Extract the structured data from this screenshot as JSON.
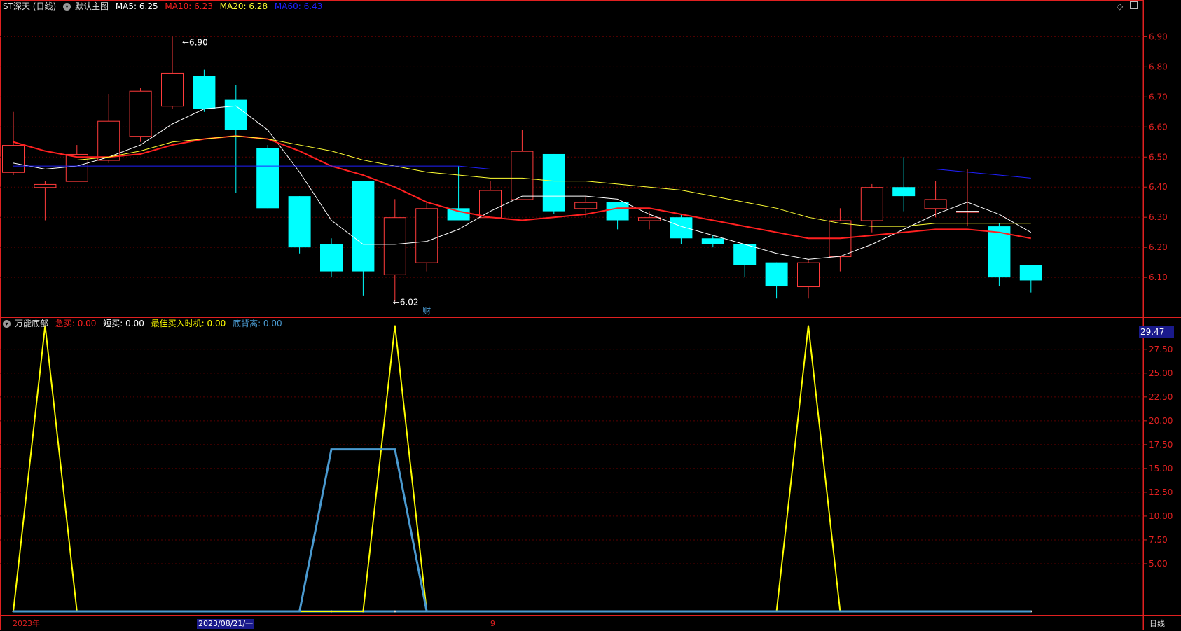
{
  "header": {
    "stock_name": "ST深天 (日线)",
    "main_chart_label": "默认主图",
    "ma5": "MA5: 6.25",
    "ma10": "MA10: 6.23",
    "ma20": "MA20: 6.28",
    "ma60": "MA60: 6.43"
  },
  "indicator": {
    "name": "万能底部",
    "series_labels": {
      "jimai": "急买: 0.00",
      "duanmai": "短买: 0.00",
      "zuijia": "最佳买入时机: 0.00",
      "dibeili": "底背离: 0.00"
    },
    "current_value": "29.47"
  },
  "annotations": {
    "high_label": "6.90",
    "low_label": "6.02",
    "fin_marker": "财"
  },
  "bottom_bar": {
    "year_label": "2023年",
    "date_label": "2023/08/21/一",
    "month_label": "9",
    "period_label": "日线"
  },
  "colors": {
    "up": "#ff3b3b",
    "down": "#00ffff",
    "ma5": "#ffffff",
    "ma10": "#ff2020",
    "ma20": "#ffff33",
    "ma60": "#2020ff",
    "zuijia": "#ffff00",
    "dibeili": "#4a9ad0",
    "axis": "#e02020"
  },
  "chart_data": [
    {
      "type": "candlestick",
      "title": "ST深天 (日线)",
      "y_ticks": [
        6.1,
        6.2,
        6.3,
        6.4,
        6.5,
        6.6,
        6.7,
        6.8,
        6.9
      ],
      "ylim": [
        5.97,
        6.98
      ],
      "candles": [
        {
          "o": 6.45,
          "h": 6.65,
          "l": 6.44,
          "c": 6.54
        },
        {
          "o": 6.4,
          "h": 6.42,
          "l": 6.29,
          "c": 6.41
        },
        {
          "o": 6.42,
          "h": 6.54,
          "l": 6.42,
          "c": 6.51
        },
        {
          "o": 6.49,
          "h": 6.71,
          "l": 6.48,
          "c": 6.62
        },
        {
          "o": 6.57,
          "h": 6.73,
          "l": 6.55,
          "c": 6.72
        },
        {
          "o": 6.67,
          "h": 6.9,
          "l": 6.66,
          "c": 6.78
        },
        {
          "o": 6.77,
          "h": 6.79,
          "l": 6.65,
          "c": 6.66
        },
        {
          "o": 6.69,
          "h": 6.74,
          "l": 6.38,
          "c": 6.59
        },
        {
          "o": 6.53,
          "h": 6.54,
          "l": 6.33,
          "c": 6.33
        },
        {
          "o": 6.37,
          "h": 6.37,
          "l": 6.18,
          "c": 6.2
        },
        {
          "o": 6.21,
          "h": 6.23,
          "l": 6.1,
          "c": 6.12
        },
        {
          "o": 6.42,
          "h": 6.42,
          "l": 6.04,
          "c": 6.12
        },
        {
          "o": 6.11,
          "h": 6.36,
          "l": 6.02,
          "c": 6.3
        },
        {
          "o": 6.15,
          "h": 6.35,
          "l": 6.12,
          "c": 6.33
        },
        {
          "o": 6.33,
          "h": 6.47,
          "l": 6.29,
          "c": 6.29
        },
        {
          "o": 6.3,
          "h": 6.42,
          "l": 6.3,
          "c": 6.39
        },
        {
          "o": 6.36,
          "h": 6.59,
          "l": 6.36,
          "c": 6.52
        },
        {
          "o": 6.51,
          "h": 6.51,
          "l": 6.31,
          "c": 6.32
        },
        {
          "o": 6.33,
          "h": 6.37,
          "l": 6.3,
          "c": 6.35
        },
        {
          "o": 6.35,
          "h": 6.35,
          "l": 6.26,
          "c": 6.29
        },
        {
          "o": 6.29,
          "h": 6.32,
          "l": 6.26,
          "c": 6.3
        },
        {
          "o": 6.3,
          "h": 6.31,
          "l": 6.21,
          "c": 6.23
        },
        {
          "o": 6.23,
          "h": 6.24,
          "l": 6.2,
          "c": 6.21
        },
        {
          "o": 6.21,
          "h": 6.21,
          "l": 6.1,
          "c": 6.14
        },
        {
          "o": 6.15,
          "h": 6.15,
          "l": 6.03,
          "c": 6.07
        },
        {
          "o": 6.07,
          "h": 6.16,
          "l": 6.03,
          "c": 6.15
        },
        {
          "o": 6.17,
          "h": 6.33,
          "l": 6.12,
          "c": 6.29
        },
        {
          "o": 6.29,
          "h": 6.41,
          "l": 6.25,
          "c": 6.4
        },
        {
          "o": 6.4,
          "h": 6.5,
          "l": 6.32,
          "c": 6.37
        },
        {
          "o": 6.33,
          "h": 6.42,
          "l": 6.3,
          "c": 6.36
        },
        {
          "o": 6.32,
          "h": 6.46,
          "l": 6.27,
          "c": 6.32
        },
        {
          "o": 6.27,
          "h": 6.28,
          "l": 6.07,
          "c": 6.1
        },
        {
          "o": 6.14,
          "h": 6.14,
          "l": 6.05,
          "c": 6.09
        }
      ],
      "series": [
        {
          "name": "MA5",
          "values": [
            6.48,
            6.46,
            6.47,
            6.5,
            6.54,
            6.61,
            6.66,
            6.67,
            6.59,
            6.45,
            6.29,
            6.21,
            6.21,
            6.22,
            6.26,
            6.32,
            6.37,
            6.37,
            6.37,
            6.36,
            6.31,
            6.27,
            6.24,
            6.21,
            6.18,
            6.16,
            6.17,
            6.21,
            6.26,
            6.31,
            6.35,
            6.31,
            6.25
          ]
        },
        {
          "name": "MA10",
          "values": [
            6.55,
            6.52,
            6.5,
            6.5,
            6.51,
            6.54,
            6.56,
            6.57,
            6.56,
            6.52,
            6.47,
            6.44,
            6.4,
            6.35,
            6.32,
            6.3,
            6.29,
            6.3,
            6.31,
            6.33,
            6.33,
            6.31,
            6.29,
            6.27,
            6.25,
            6.23,
            6.23,
            6.24,
            6.25,
            6.26,
            6.26,
            6.25,
            6.23
          ]
        },
        {
          "name": "MA20",
          "values": [
            6.49,
            6.49,
            6.49,
            6.5,
            6.52,
            6.55,
            6.56,
            6.57,
            6.56,
            6.54,
            6.52,
            6.49,
            6.47,
            6.45,
            6.44,
            6.43,
            6.43,
            6.42,
            6.42,
            6.41,
            6.4,
            6.39,
            6.37,
            6.35,
            6.33,
            6.3,
            6.28,
            6.27,
            6.27,
            6.28,
            6.28,
            6.28,
            6.28
          ]
        },
        {
          "name": "MA60",
          "values": [
            6.47,
            6.47,
            6.47,
            6.47,
            6.47,
            6.47,
            6.47,
            6.47,
            6.47,
            6.47,
            6.47,
            6.47,
            6.47,
            6.47,
            6.47,
            6.46,
            6.46,
            6.46,
            6.46,
            6.46,
            6.46,
            6.46,
            6.46,
            6.46,
            6.46,
            6.46,
            6.46,
            6.46,
            6.46,
            6.46,
            6.45,
            6.44,
            6.43
          ]
        }
      ]
    },
    {
      "type": "line",
      "title": "万能底部",
      "y_ticks": [
        5.0,
        7.5,
        10.0,
        12.5,
        15.0,
        17.5,
        20.0,
        22.5,
        25.0,
        27.5
      ],
      "ylim": [
        0,
        29.47
      ],
      "series": [
        {
          "name": "最佳买入时机",
          "values": [
            0,
            30,
            0,
            0,
            0,
            0,
            0,
            0,
            0,
            0,
            0,
            0,
            30,
            0,
            0,
            0,
            0,
            0,
            0,
            0,
            0,
            0,
            0,
            0,
            0,
            30,
            0,
            0,
            0,
            0,
            0,
            0,
            0
          ]
        },
        {
          "name": "底背离",
          "values": [
            0,
            0,
            0,
            0,
            0,
            0,
            0,
            0,
            0,
            0,
            17,
            17,
            17,
            0,
            0,
            0,
            0,
            0,
            0,
            0,
            0,
            0,
            0,
            0,
            0,
            0,
            0,
            0,
            0,
            0,
            0,
            0,
            0
          ]
        }
      ]
    }
  ]
}
